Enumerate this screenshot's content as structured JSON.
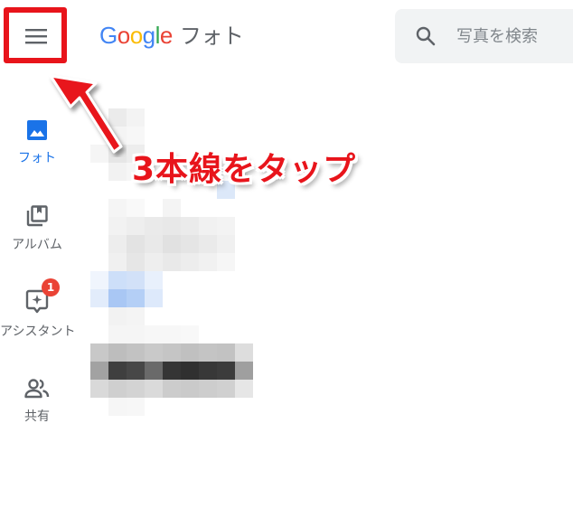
{
  "header": {
    "menu_icon": "hamburger-menu-icon",
    "logo": {
      "letters": [
        "G",
        "o",
        "o",
        "g",
        "l",
        "e"
      ],
      "letter_colors": [
        "#4285f4",
        "#ea4335",
        "#fbbc05",
        "#4285f4",
        "#34a853",
        "#ea4335"
      ],
      "product": "フォト"
    },
    "search": {
      "icon": "search-icon",
      "placeholder": "写真を検索"
    }
  },
  "nav": {
    "active_color": "#1a73e8",
    "items": [
      {
        "label": "フォト",
        "icon": "photo-icon",
        "active": true
      },
      {
        "label": "アルバム",
        "icon": "album-icon",
        "active": false
      },
      {
        "label": "アシスタント",
        "icon": "assistant-icon",
        "active": false,
        "badge": "1"
      },
      {
        "label": "共有",
        "icon": "people-icon",
        "active": false
      }
    ]
  },
  "annotation": {
    "text": "3本線をタップ",
    "color": "#e8141b"
  }
}
